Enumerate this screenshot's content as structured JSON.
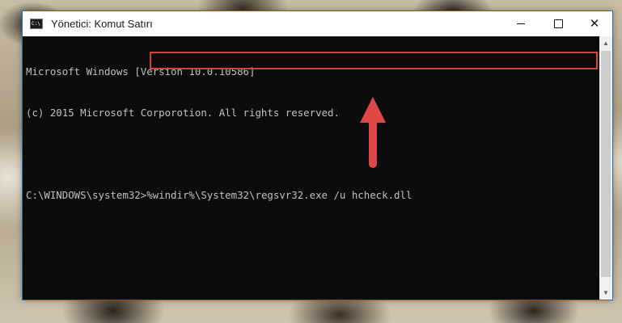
{
  "window": {
    "title": "Yönetici: Komut Satırı",
    "icon": "cmd-icon",
    "icon_text": "C:\\",
    "controls": {
      "minimize": "minimize-icon",
      "maximize": "maximize-icon",
      "close": "close-icon"
    }
  },
  "console": {
    "lines": [
      "Microsoft Windows [Version 10.0.10586]",
      "(c) 2015 Microsoft Corporotion. All rights reserved.",
      "",
      ""
    ],
    "prompt": "C:\\WINDOWS\\system32>",
    "command": "%windir%\\System32\\regsvr32.exe /u hcheck.dll"
  },
  "annotation": {
    "highlight_color": "#d94040",
    "arrow_color": "#e04848"
  },
  "scrollbar": {
    "up": "scroll-up-icon",
    "down": "scroll-down-icon"
  }
}
